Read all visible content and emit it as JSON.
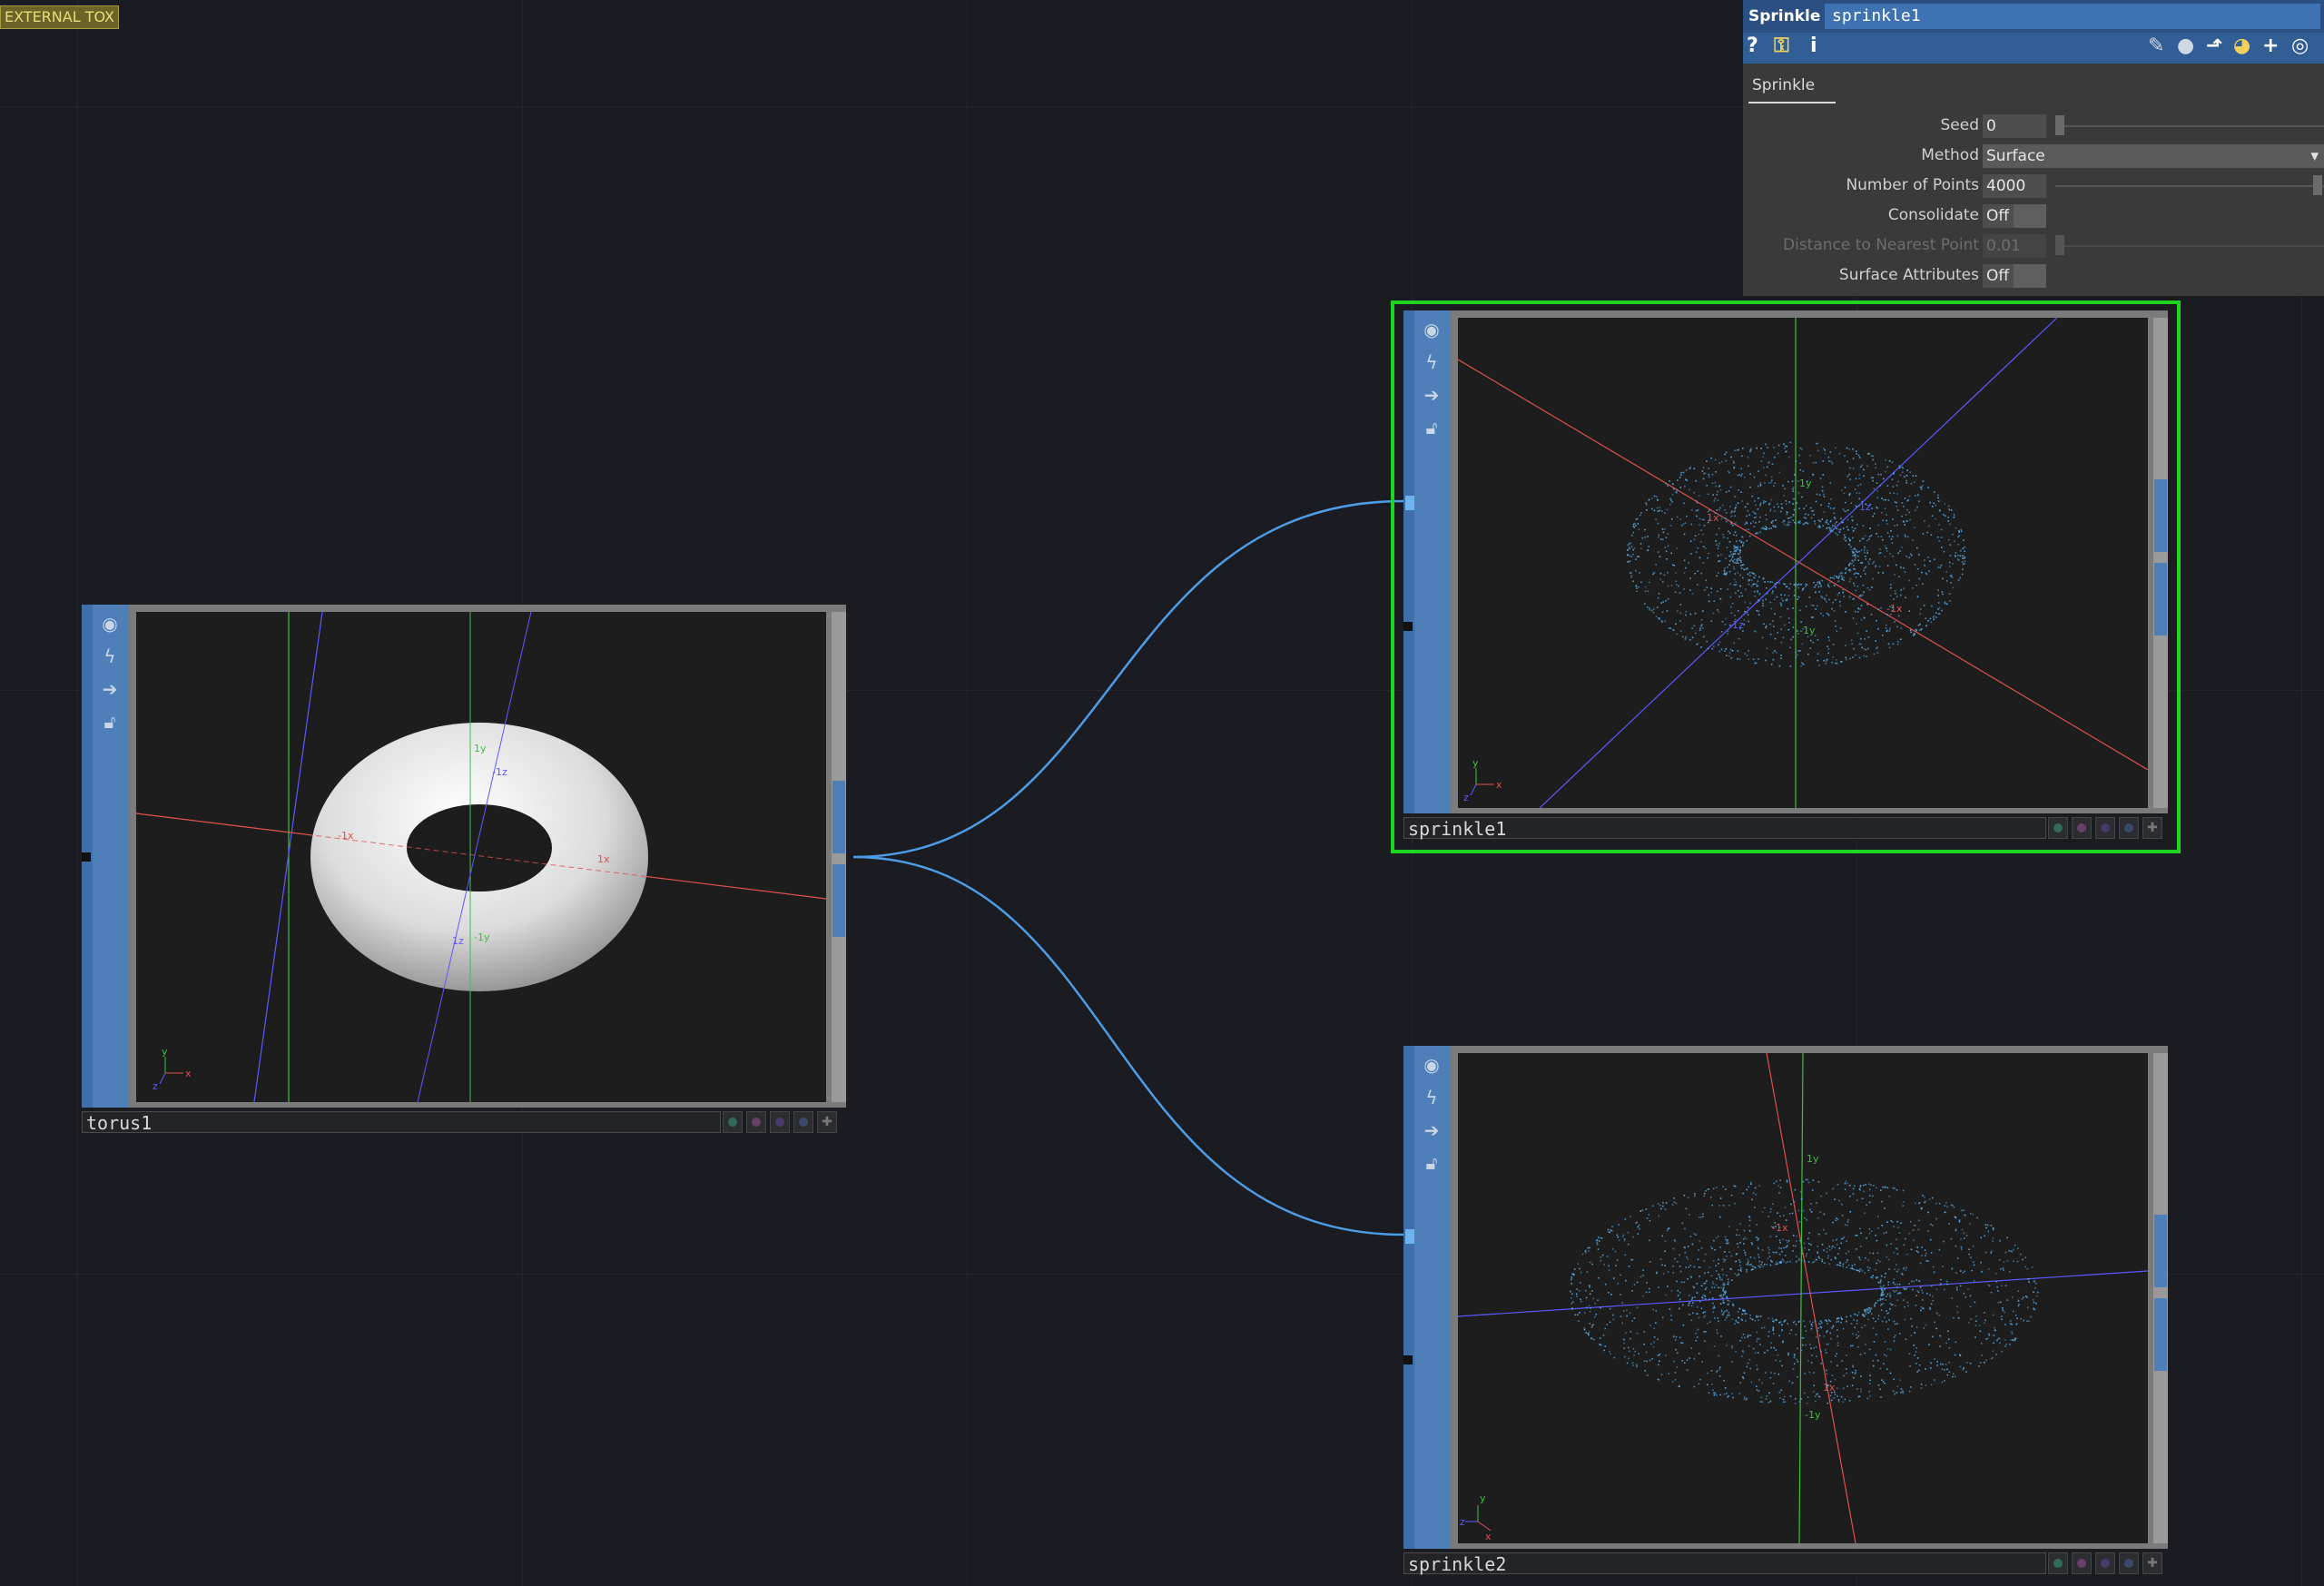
{
  "external_tag": "EXTERNAL TOX",
  "nodes": {
    "torus1": {
      "name": "torus1"
    },
    "sprinkle1": {
      "name": "sprinkle1"
    },
    "sprinkle2": {
      "name": "sprinkle2"
    }
  },
  "viewer_axes": {
    "torus1": {
      "y_top": "1y",
      "z_top": "-1z",
      "x_left": "-1x",
      "x_right": "1x",
      "z_bottom": "1z",
      "y_bottom": "-1y"
    },
    "sprinkle1": {
      "y_top": "1y",
      "x_left": "1x",
      "z_right": "1z",
      "x_right": "-1x",
      "z_left": "-1z",
      "y_bottom": "-1y"
    },
    "sprinkle2": {
      "y_top": "1y",
      "x_top": "-1x",
      "x_bottom": "1x",
      "y_bottom": "-1y"
    },
    "gizmo": {
      "x": "x",
      "y": "y",
      "z": "z"
    }
  },
  "params": {
    "op_type": "Sprinkle",
    "op_name": "sprinkle1",
    "tab": "Sprinkle",
    "seed": {
      "label": "Seed",
      "value": "0"
    },
    "method": {
      "label": "Method",
      "value": "Surface"
    },
    "num_points": {
      "label": "Number of Points",
      "value": "4000"
    },
    "consolidate": {
      "label": "Consolidate",
      "value": "Off"
    },
    "distance": {
      "label": "Distance to Nearest Point",
      "value": "0.01"
    },
    "surface_attributes": {
      "label": "Surface Attributes",
      "value": "Off"
    }
  },
  "colors": {
    "wire": "#4d9ce6",
    "selected": "#1fd51f",
    "node_sidebar": "#4f7fb8",
    "axis_x": "#e05050",
    "axis_y": "#3fbf3f",
    "axis_z": "#5a5aff",
    "points": "#59a8e0"
  }
}
